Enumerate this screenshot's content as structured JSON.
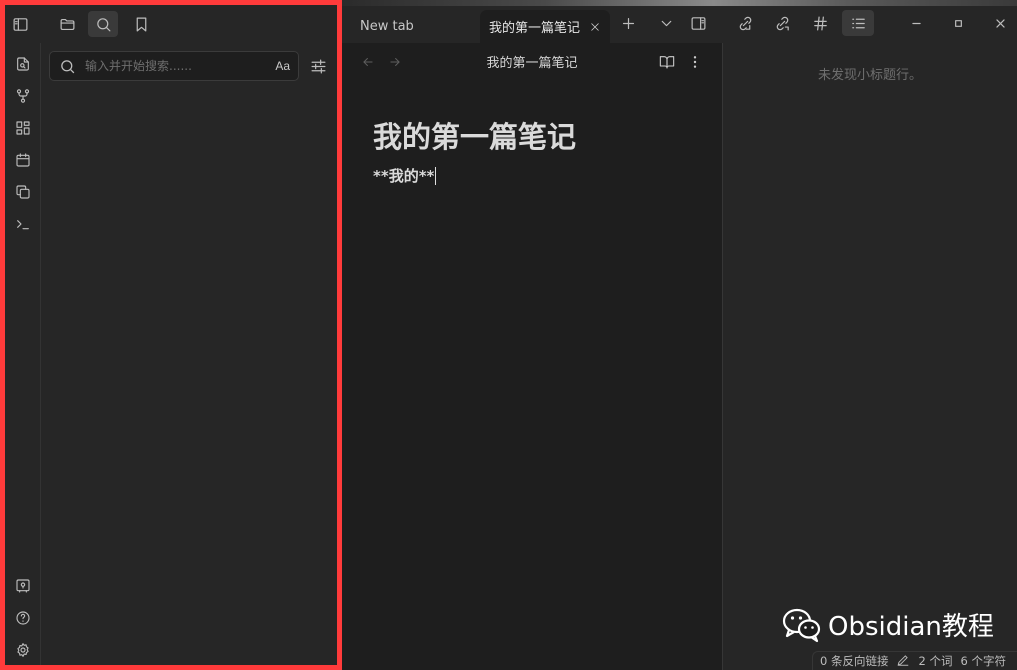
{
  "tabs": [
    {
      "label": "New tab"
    },
    {
      "label": "我的第一篇笔记"
    }
  ],
  "search": {
    "placeholder": "输入并开始搜索......",
    "match_case_label": "Aa"
  },
  "editor": {
    "view_title": "我的第一篇笔记",
    "note_title": "我的第一篇笔记",
    "line1": "**我的**"
  },
  "outline": {
    "empty_text": "未发现小标题行。"
  },
  "status": {
    "backlinks": "0 条反向链接",
    "words": "2 个词",
    "chars": "6 个字符"
  },
  "watermark": {
    "text": "Obsidian教程"
  },
  "colors": {
    "highlight_frame": "#ff3b3b",
    "background": "#1e1e1e",
    "sidebar": "#262626"
  }
}
